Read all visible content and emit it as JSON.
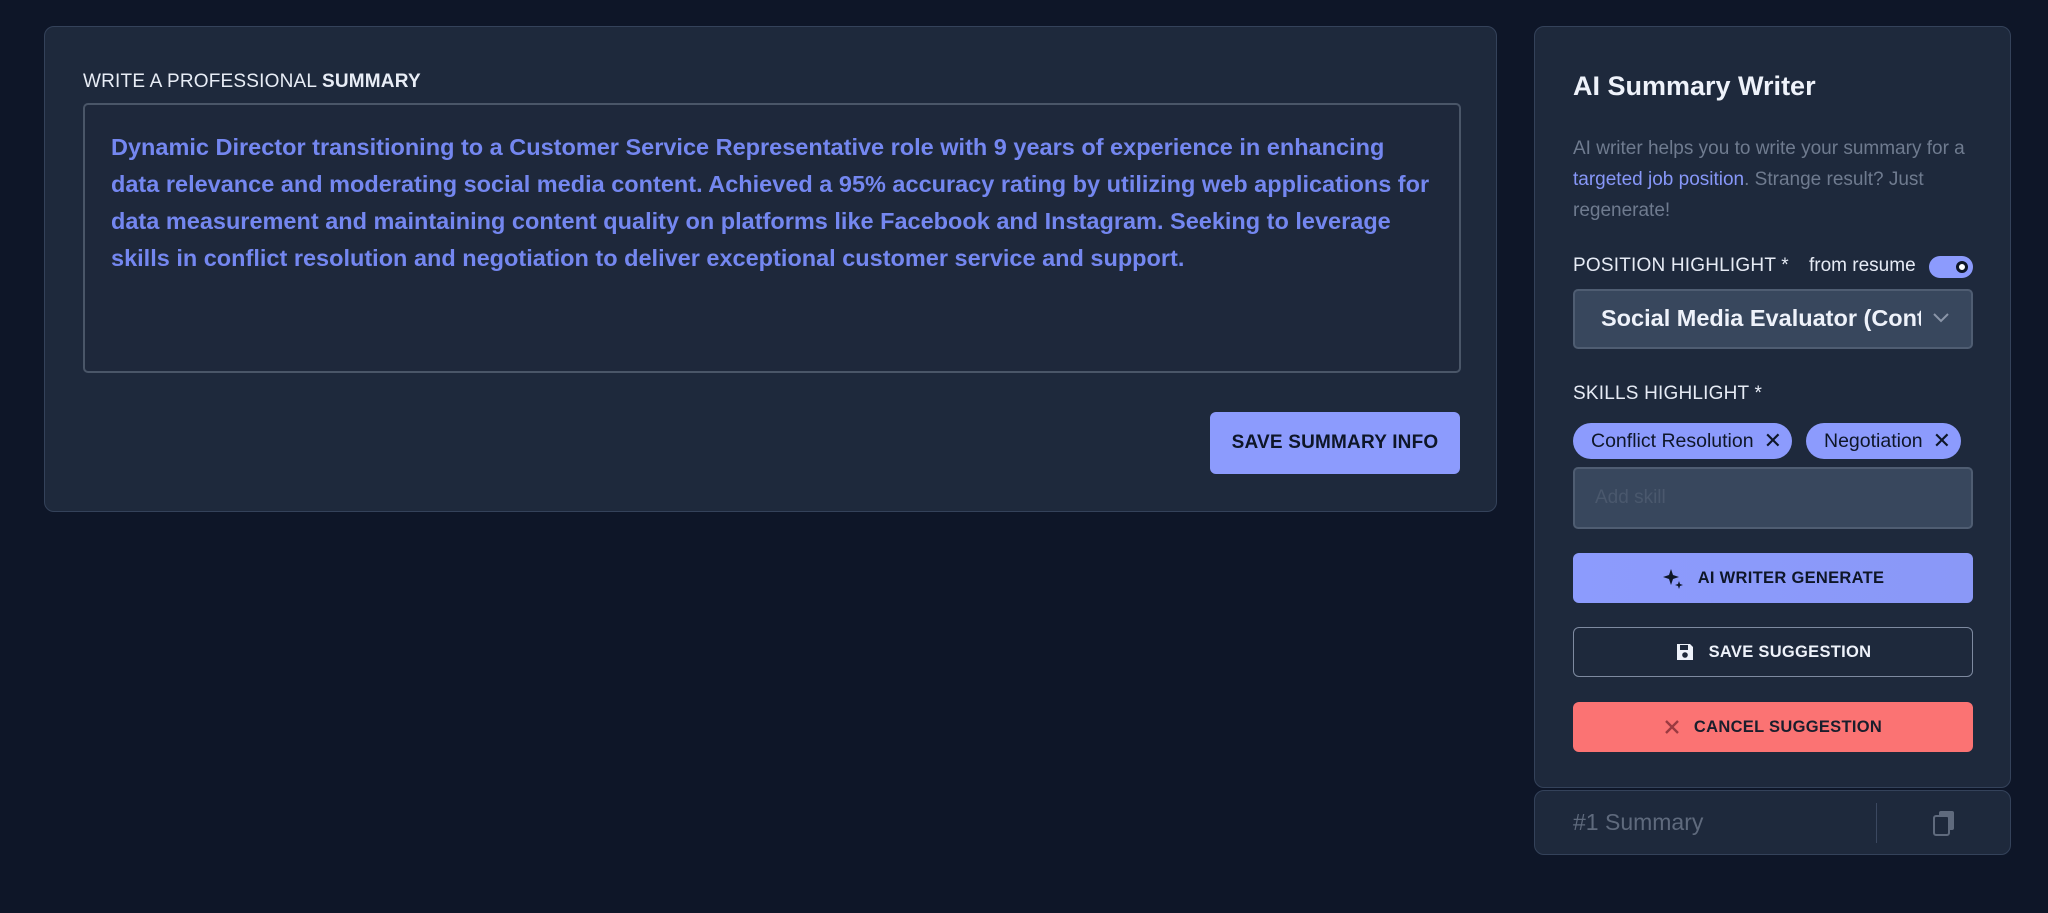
{
  "summary_section": {
    "label_prefix": "WRITE A PROFESSIONAL",
    "label_bold": "SUMMARY",
    "text": "Dynamic Director transitioning to a Customer Service Representative role with 9 years of experience in enhancing data relevance and moderating social media content. Achieved a 95% accuracy rating by utilizing web applications for data measurement and maintaining content quality on platforms like Facebook and Instagram. Seeking to leverage skills in conflict resolution and negotiation to deliver exceptional customer service and support.",
    "save_label": "SAVE SUMMARY INFO"
  },
  "ai_panel": {
    "title": "AI Summary Writer",
    "desc_before": "AI writer helps you to write your summary for a ",
    "desc_link": "targeted job position",
    "desc_after": ". Strange result? Just regenerate!",
    "position_label": "POSITION HIGHLIGHT *",
    "from_resume_label": "from resume",
    "toggle_on": true,
    "position_value": "Social Media Evaluator (Contract)",
    "skills_label": "SKILLS HIGHLIGHT *",
    "skills": [
      "Conflict Resolution",
      "Negotiation"
    ],
    "skills_input_placeholder": "Add skill",
    "generate_label": "AI WRITER GENERATE",
    "save_label": "SAVE SUGGESTION",
    "cancel_label": "CANCEL SUGGESTION"
  },
  "suggestions": {
    "tab_label": "#1 Summary"
  },
  "colors": {
    "background": "#0e1628",
    "card": "#1e293c",
    "accent": "#8c9bfd",
    "summary_text": "#7487f0",
    "danger": "#fb7373"
  }
}
